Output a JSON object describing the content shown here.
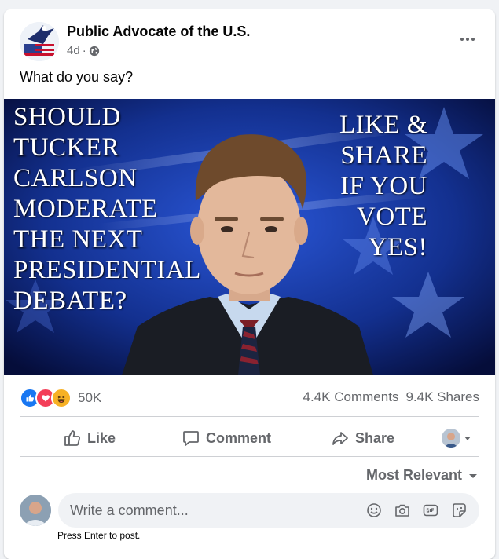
{
  "post": {
    "page_name": "Public Advocate of the U.S.",
    "time": "4d",
    "separator": "·",
    "privacy_icon": "globe-icon",
    "text": "What do you say?"
  },
  "image": {
    "left_text": "SHOULD\nTUCKER\nCARLSON\nMODERATE\nTHE NEXT\nPRESIDENTIAL\nDEBATE?",
    "right_text": "LIKE &\nSHARE\nIF YOU\nVOTE\nYES!"
  },
  "stats": {
    "reaction_icons": [
      "like-icon",
      "love-icon",
      "haha-icon"
    ],
    "reaction_count": "50K",
    "comments": "4.4K Comments",
    "shares": "9.4K Shares"
  },
  "actions": {
    "like": "Like",
    "comment": "Comment",
    "share": "Share"
  },
  "sort": {
    "label": "Most Relevant"
  },
  "composer": {
    "placeholder": "Write a comment...",
    "hint": "Press Enter to post."
  },
  "colors": {
    "secondary_text": "#65676b",
    "like_blue": "#1877f2",
    "love_red": "#f33e58",
    "haha_yellow": "#f7b125"
  }
}
